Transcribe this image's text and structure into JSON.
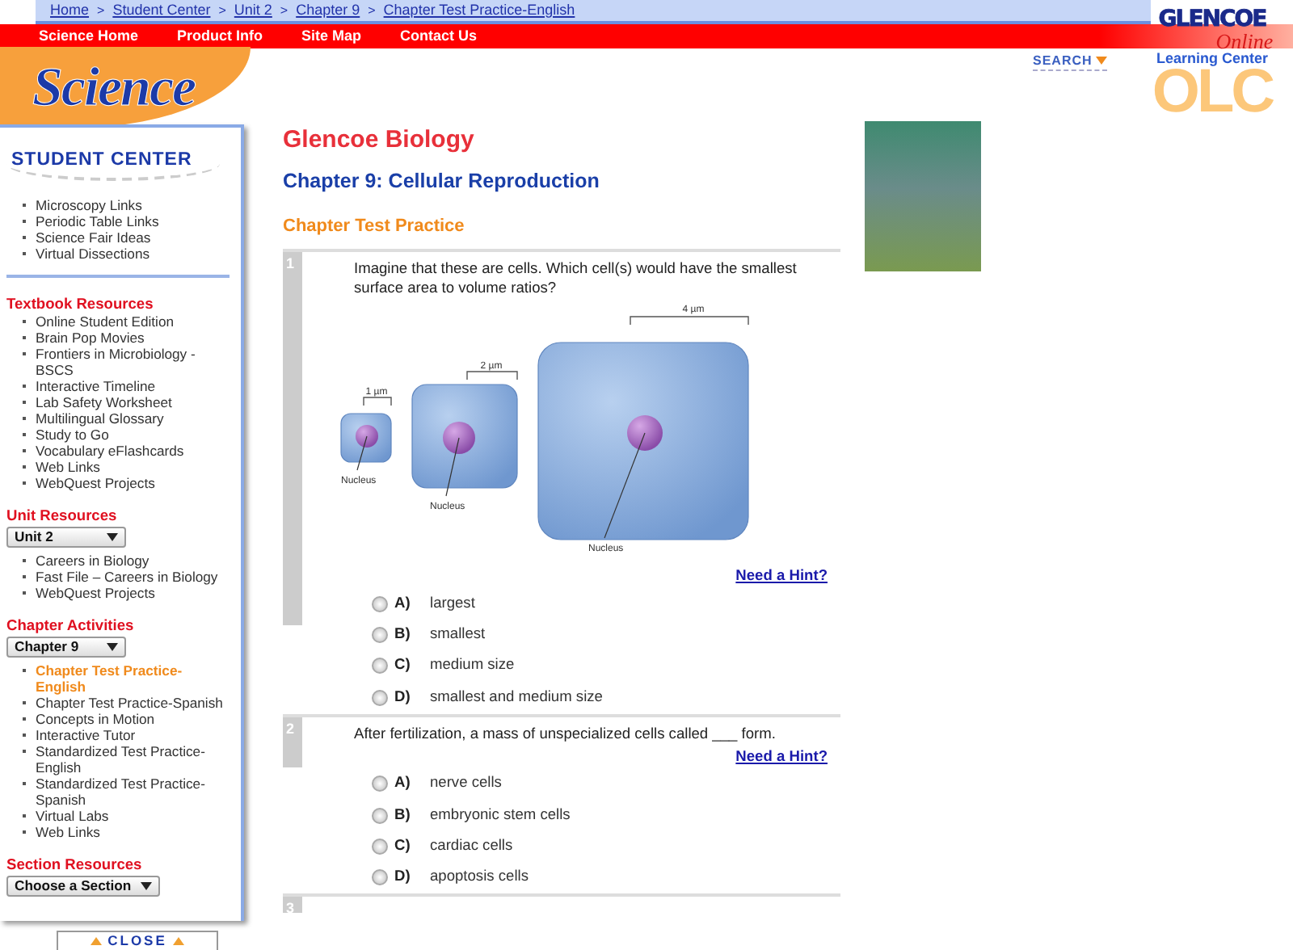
{
  "breadcrumb": [
    {
      "label": "Home"
    },
    {
      "label": "Student Center"
    },
    {
      "label": "Unit 2"
    },
    {
      "label": "Chapter 9"
    },
    {
      "label": "Chapter Test Practice-English"
    }
  ],
  "breadcrumb_separator": ">",
  "nav": [
    "Science Home",
    "Product Info",
    "Site Map",
    "Contact Us"
  ],
  "logo": {
    "text": "Science"
  },
  "search": {
    "label": "SEARCH"
  },
  "olc_logo": {
    "brand": "GLENCOE",
    "script": "Online",
    "tagline": "Learning Center",
    "letters": "OLC"
  },
  "sidebar": {
    "heading": "STUDENT CENTER",
    "links": [
      "Microscopy Links",
      "Periodic Table Links",
      "Science Fair Ideas",
      "Virtual Dissections"
    ],
    "sections": [
      {
        "title": "Textbook Resources",
        "links": [
          {
            "label": "Online Student Edition"
          },
          {
            "label": "Brain Pop Movies"
          },
          {
            "label": "Frontiers in Microbiology - BSCS"
          },
          {
            "label": "Interactive Timeline"
          },
          {
            "label": "Lab Safety Worksheet"
          },
          {
            "label": "Multilingual Glossary"
          },
          {
            "label": "Study to Go"
          },
          {
            "label": "Vocabulary eFlashcards"
          },
          {
            "label": "Web Links"
          },
          {
            "label": "WebQuest Projects"
          }
        ]
      },
      {
        "title": "Unit Resources",
        "dropdown": "Unit 2",
        "links": [
          {
            "label": "Careers in Biology"
          },
          {
            "label": "Fast File – Careers in Biology"
          },
          {
            "label": "WebQuest Projects"
          }
        ]
      },
      {
        "title": "Chapter Activities",
        "dropdown": "Chapter 9",
        "links": [
          {
            "label": "Chapter Test Practice-English",
            "selected": true
          },
          {
            "label": "Chapter Test Practice-Spanish",
            "selected": false
          },
          {
            "label": "Concepts in Motion",
            "selected": false
          },
          {
            "label": "Interactive Tutor",
            "selected": false
          },
          {
            "label": "Standardized Test Practice-English",
            "selected": false
          },
          {
            "label": "Standardized Test Practice-Spanish",
            "selected": false
          },
          {
            "label": "Virtual Labs",
            "selected": false
          },
          {
            "label": "Web Links",
            "selected": false
          }
        ]
      },
      {
        "title": "Section Resources",
        "dropdown": "Choose a Section"
      }
    ],
    "close": "CLOSE"
  },
  "main": {
    "title": "Glencoe Biology",
    "chapter": "Chapter 9: Cellular Reproduction",
    "subtitle": "Chapter Test Practice",
    "questions": [
      {
        "number": "1",
        "text": "Imagine that these are cells. Which cell(s) would have the smallest surface area to volume ratios?",
        "figure": {
          "scales": [
            "1 µm",
            "2 µm",
            "4 µm"
          ],
          "nucleus_labels": [
            "Nucleus",
            "Nucleus",
            "Nucleus"
          ]
        },
        "hint": "Need a Hint?",
        "options": [
          {
            "letter": "A)",
            "text": "largest",
            "selected": false
          },
          {
            "letter": "B)",
            "text": "smallest",
            "selected": false
          },
          {
            "letter": "C)",
            "text": "medium size",
            "selected": false
          },
          {
            "letter": "D)",
            "text": "smallest and medium size",
            "selected": false
          }
        ]
      },
      {
        "number": "2",
        "text": "After fertilization, a mass of unspecialized cells called ___ form.",
        "hint": "Need a Hint?",
        "options": [
          {
            "letter": "A)",
            "text": "nerve cells",
            "selected": false
          },
          {
            "letter": "B)",
            "text": "embryonic stem cells",
            "selected": false
          },
          {
            "letter": "C)",
            "text": "cardiac cells",
            "selected": false
          },
          {
            "letter": "D)",
            "text": "apoptosis cells",
            "selected": false
          }
        ]
      },
      {
        "number": "3"
      }
    ]
  }
}
